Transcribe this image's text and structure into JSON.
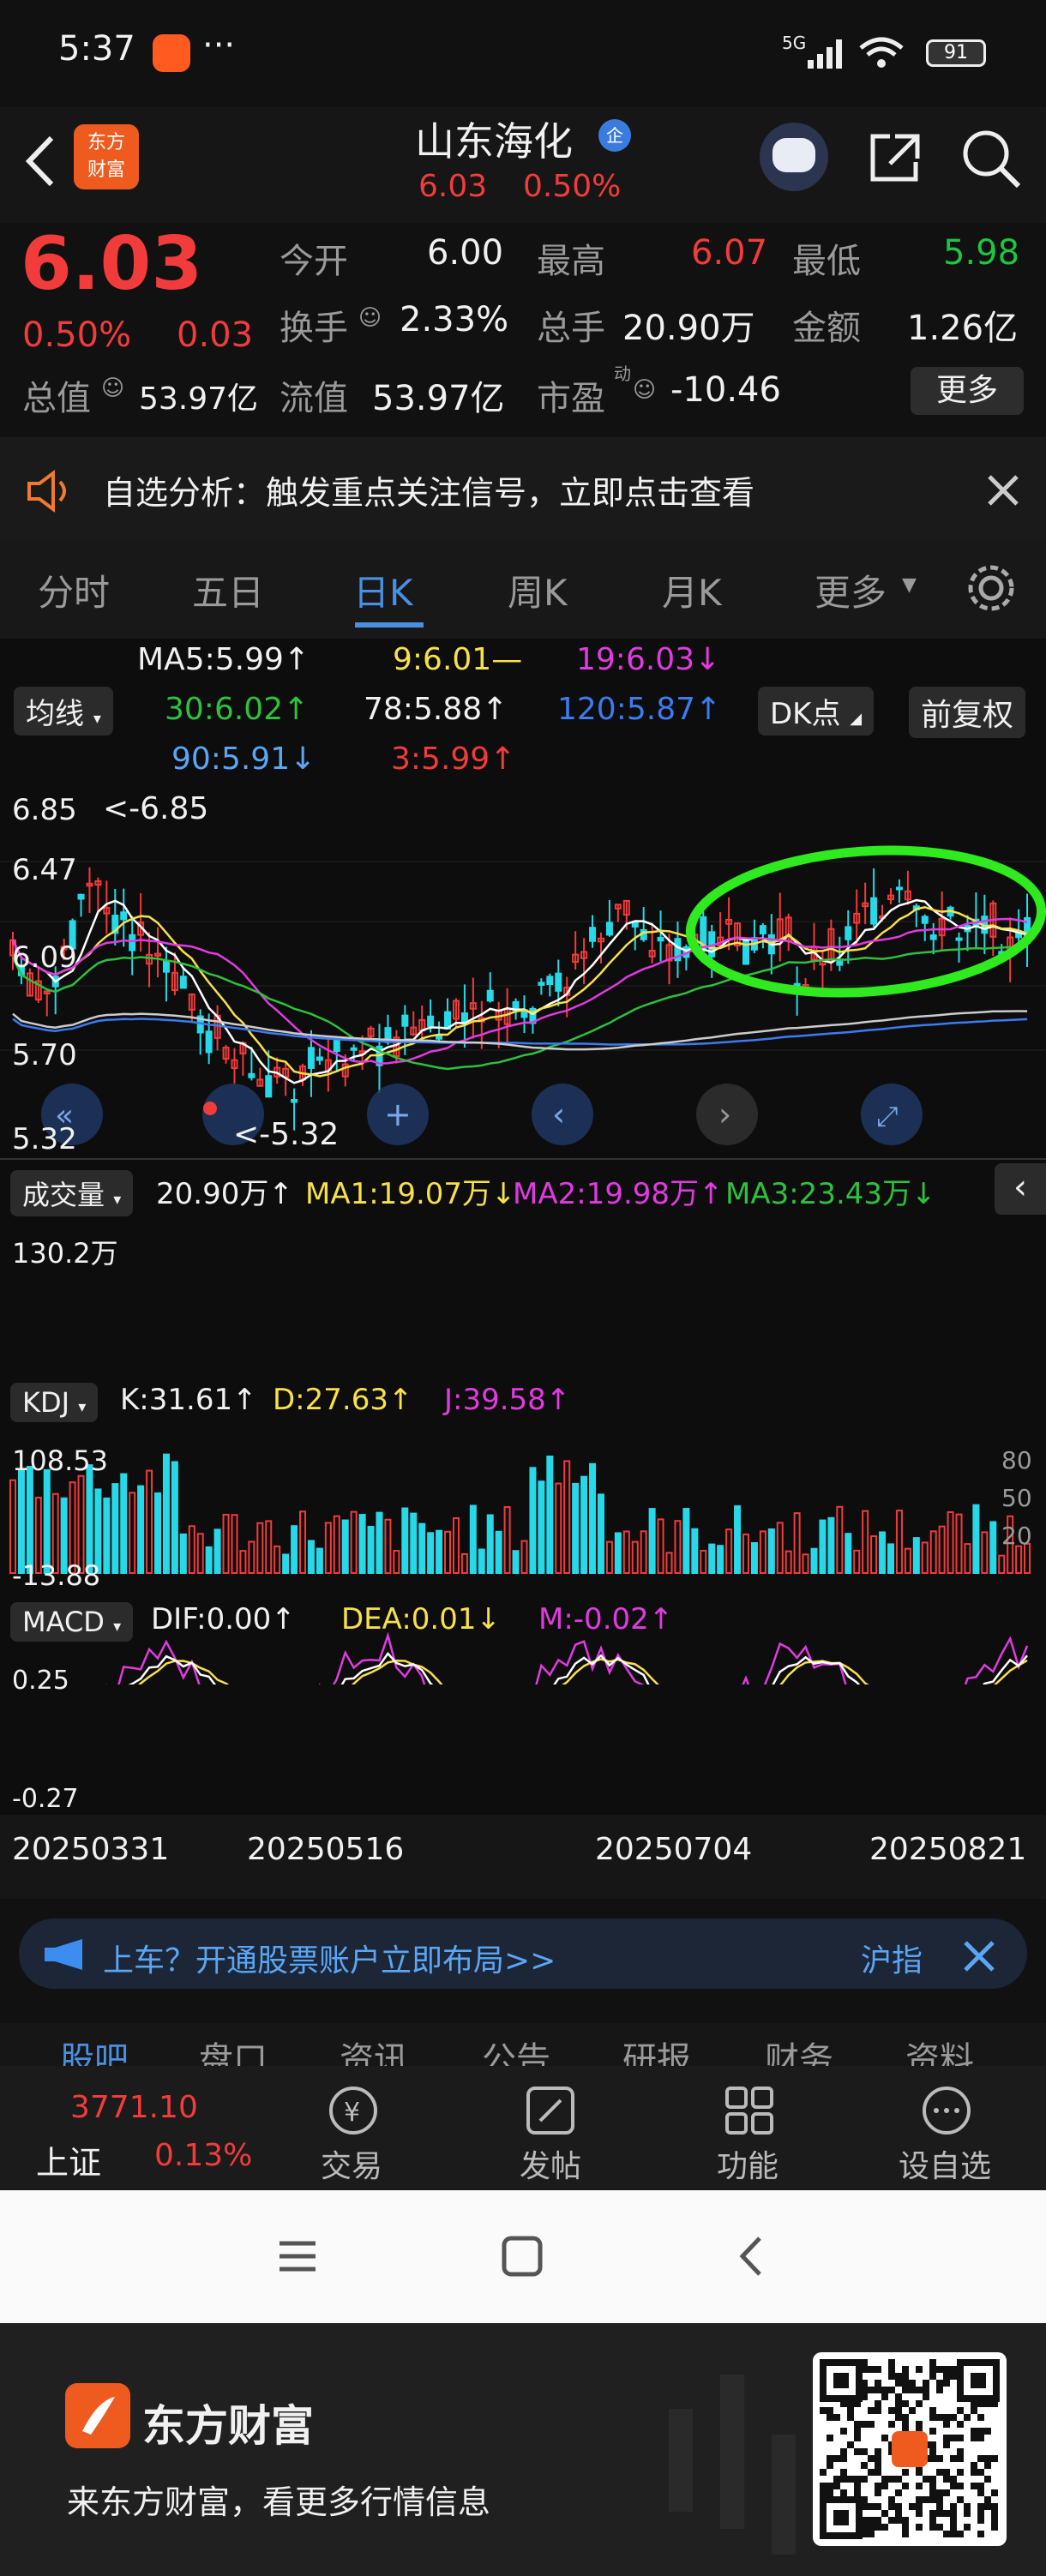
{
  "status": {
    "time": "5:37",
    "dots": "···",
    "net": "5G",
    "battery": "91"
  },
  "header": {
    "title": "山东海化",
    "badge": "企",
    "price": "6.03",
    "pct": "0.50%"
  },
  "quote": {
    "price": "6.03",
    "pct": "0.50%",
    "chg": "0.03",
    "open_l": "今开",
    "open_v": "6.00",
    "high_l": "最高",
    "high_v": "6.07",
    "low_l": "最低",
    "low_v": "5.98",
    "turn_l": "换手",
    "turn_v": "2.33%",
    "vol_l": "总手",
    "vol_v": "20.90万",
    "amt_l": "金额",
    "amt_v": "1.26亿",
    "cap_l": "总值",
    "cap_v": "53.97亿",
    "float_l": "流值",
    "float_v": "53.97亿",
    "pe_l": "市盈",
    "pe_sup": "动",
    "pe_v": "-10.46",
    "more": "更多"
  },
  "notice": {
    "text": "自选分析：触发重点关注信号，立即点击查看"
  },
  "tabs": {
    "items": [
      "分时",
      "五日",
      "日K",
      "周K",
      "月K",
      "更多"
    ],
    "active": 2
  },
  "ma": {
    "ma_btn": "均线",
    "ma5": "MA5:5.99↑",
    "ma9": "9:6.01—",
    "ma19": "19:6.03↓",
    "ma30": "30:6.02↑",
    "ma78": "78:5.88↑",
    "ma120": "120:5.87↑",
    "ma90": "90:5.91↓",
    "ma3": "3:5.99↑",
    "dk": "DK点",
    "adj": "前复权"
  },
  "kline": {
    "y_top": "6.85",
    "y_mid": "6.47",
    "y_3": "6.09",
    "y_4": "5.70",
    "y_bot": "5.32",
    "max_label": "<-6.85",
    "min_label": "<-5.32"
  },
  "volume": {
    "btn": "成交量",
    "v": "20.90万↑",
    "ma1": "MA1:19.07万↓",
    "ma2": "MA2:19.98万↑",
    "ma3": "MA3:23.43万↓",
    "axis": "130.2万"
  },
  "kdj": {
    "btn": "KDJ",
    "k": "K:31.61↑",
    "d": "D:27.63↑",
    "j": "J:39.58↑",
    "top": "108.53",
    "bot": "-13.88",
    "l80": "80",
    "l50": "50",
    "l20": "20"
  },
  "macd": {
    "btn": "MACD",
    "dif": "DIF:0.00↑",
    "dea": "DEA:0.01↓",
    "m": "M:-0.02↑",
    "top": "0.25",
    "bot": "-0.27"
  },
  "dates": [
    "20250331",
    "20250516",
    "20250704",
    "20250821"
  ],
  "ad": {
    "text": "上车？开通股票账户立即布局>>",
    "tag": "沪指"
  },
  "bottom_tabs": [
    "股吧",
    "盘口",
    "资讯",
    "公告",
    "研报",
    "财务",
    "资料"
  ],
  "index": {
    "value": "3771.10",
    "name": "上证",
    "pct": "0.13%"
  },
  "actions": [
    "交易",
    "发帖",
    "功能",
    "设自选"
  ],
  "footer": {
    "brand": "东方财富",
    "slogan": "来东方财富，看更多行情信息",
    "logo_text": "东方财富"
  },
  "colors": {
    "up": "#f23b3b",
    "down": "#1fc443",
    "accent": "#4a90e2"
  }
}
